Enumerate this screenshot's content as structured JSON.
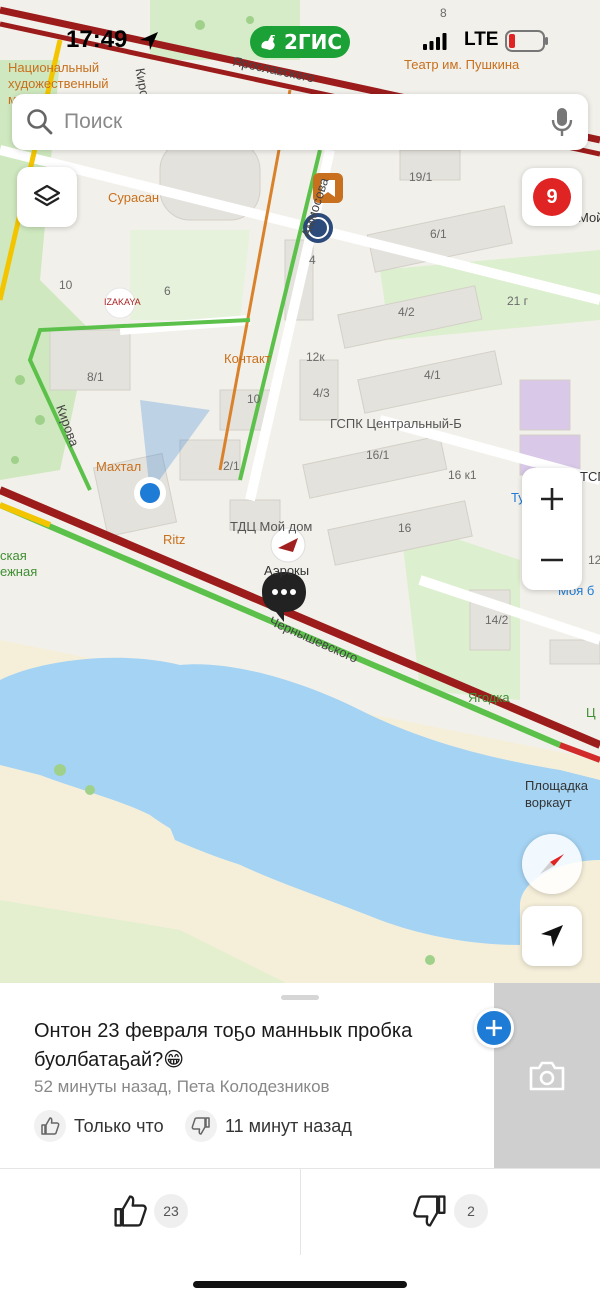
{
  "status_bar": {
    "time": "17:49",
    "network": "LTE",
    "brand": "2ГИС"
  },
  "search": {
    "placeholder": "Поиск"
  },
  "map": {
    "notifications_count": "9",
    "labels": {
      "museum": "Национальный художественный музей",
      "theater": "Театр им. Пушкина",
      "yaroslavsky": "Ярославского",
      "surasan": "Сурасан",
      "izakaya": "IZAKAYA",
      "ammosova": "Аммосова",
      "kirova_top": "Кирова",
      "kirova": "Кирова",
      "kontakt": "Контакт",
      "makhtal": "Махтал",
      "ritz": "Ritz",
      "tdts": "ТДЦ Мой дом",
      "aeroky": "Аэрокы",
      "gspk": "ГСПК Центральный-Б",
      "chernyshevskogo": "Чернышевского",
      "yagodka": "Ягодка",
      "ploshchadka": "Площадка воркаут",
      "tu": "Ту",
      "moya_b": "Моя б",
      "moi": "Мой",
      "tspk": "ТСПК",
      "ts": "Ц",
      "park": "ская ежная",
      "b8": "8",
      "b19_1": "19/1",
      "b6_1": "6/1",
      "b4": "4",
      "b10a": "10",
      "b6": "6",
      "b4_2": "4/2",
      "b21g": "21 г",
      "b12k": "12к",
      "b4_3": "4/3",
      "b4_1": "4/1",
      "b8_1": "8/1",
      "b10b": "10",
      "b16_1": "16/1",
      "b16k1": "16 к1",
      "b2_1": "2/1",
      "b16": "16",
      "b14_2": "14/2",
      "b12": "12"
    },
    "colors": {
      "traffic_red": "#9c1c1c",
      "traffic_green": "#5cc14a",
      "traffic_yellow": "#f2c500",
      "water": "#a5d3f3",
      "accent_blue": "#1e7bd6",
      "brand_green": "#1ba136"
    }
  },
  "sheet": {
    "comment_text": "Онтон 23 февраля тоҕо манньык пробка буолбатаҕай?😁",
    "comment_meta": "52 минуты назад, Пета Колодезников",
    "like_label": "Только что",
    "dislike_label": "11 минут назад",
    "votes_up": "23",
    "votes_down": "2"
  }
}
